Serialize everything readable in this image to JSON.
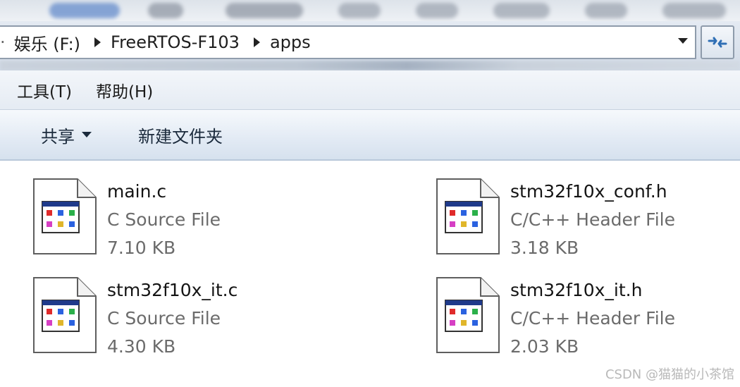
{
  "address": {
    "segments": [
      "娱乐 (F:)",
      "FreeRTOS-F103",
      "apps"
    ]
  },
  "menu": {
    "items": [
      "工具(T)",
      "帮助(H)"
    ]
  },
  "toolbar": {
    "share_label": "共享",
    "new_folder_label": "新建文件夹"
  },
  "files": [
    {
      "name": "main.c",
      "type": "C Source File",
      "size": "7.10 KB"
    },
    {
      "name": "stm32f10x_conf.h",
      "type": "C/C++ Header File",
      "size": "3.18 KB"
    },
    {
      "name": "stm32f10x_it.c",
      "type": "C Source File",
      "size": "4.30 KB"
    },
    {
      "name": "stm32f10x_it.h",
      "type": "C/C++ Header File",
      "size": "2.03 KB"
    }
  ],
  "watermark": "CSDN @猫猫的小茶馆",
  "colors": {
    "accent": "#2f6fb5",
    "toolbar_text": "#1b2a3c",
    "meta_text": "#6b6b6b"
  }
}
